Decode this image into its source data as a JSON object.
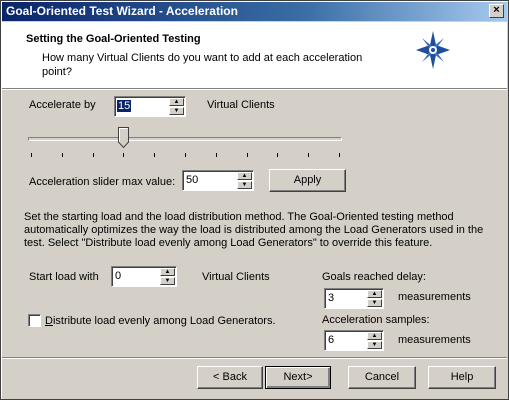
{
  "window": {
    "title": "Goal-Oriented Test Wizard - Acceleration",
    "close_label": "×"
  },
  "header": {
    "title": "Setting the Goal-Oriented Testing",
    "subtitle": "How many Virtual Clients do you want to add at each  acceleration point?",
    "logo_icon": "star-compass-icon"
  },
  "accelerate": {
    "label": "Accelerate by",
    "value": "15",
    "unit": "Virtual Clients"
  },
  "slider": {
    "value": 15,
    "max": 50,
    "tick_count": 11
  },
  "slider_max": {
    "label": "Acceleration slider max value:",
    "value": "50",
    "apply_label": "Apply"
  },
  "description": "Set the starting load and the load distribution method. The Goal-Oriented testing method automatically optimizes the way the load is distributed among the Load Generators used in the test. Select \"Distribute load evenly among Load Generators\" to override this feature.",
  "start_load": {
    "label": "Start load with",
    "value": "0",
    "unit": "Virtual Clients"
  },
  "distribute": {
    "label_first": "D",
    "label_rest": "istribute load evenly among Load Generators.",
    "checked": false
  },
  "goals_delay": {
    "label": "Goals reached delay:",
    "value": "3",
    "unit": "measurements"
  },
  "accel_samples": {
    "label": "Acceleration samples:",
    "value": "6",
    "unit": "measurements"
  },
  "buttons": {
    "back": "< Back",
    "next": "Next>",
    "cancel": "Cancel",
    "help": "Help"
  }
}
